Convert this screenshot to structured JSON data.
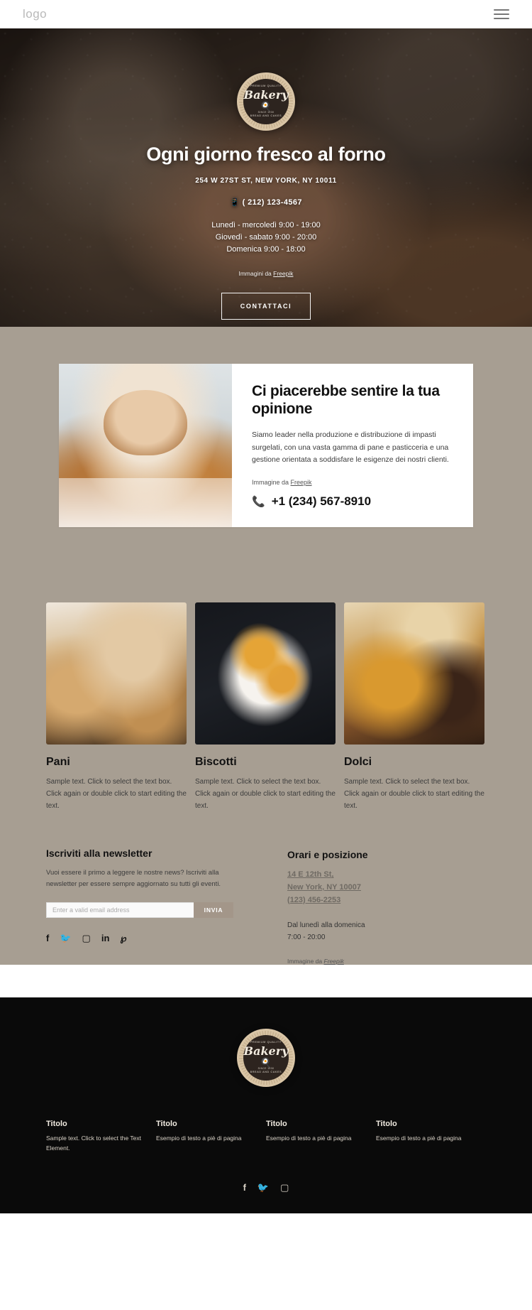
{
  "header": {
    "logo": "logo",
    "menu_icon": "hamburger-menu-icon"
  },
  "hero": {
    "badge": {
      "top": "PREMIUM QUALITY",
      "name": "Bakery",
      "since": "SINCE 1930",
      "bottom": "BREAD AND CAKES"
    },
    "title": "Ogni giorno fresco al forno",
    "address": "254 W 27ST ST, NEW YORK, NY 10011",
    "phone": "( 212) 123-4567",
    "hours": [
      "Lunedì - mercoledì 9:00 - 19:00",
      "Giovedì - sabato 9:00 - 20:00",
      "Domenica 9:00 - 18:00"
    ],
    "credit_prefix": "Immagini da ",
    "credit_link": "Freepik",
    "cta": "CONTATTACI"
  },
  "feature": {
    "title": "Ci piacerebbe sentire la tua opinione",
    "text": "Siamo leader nella produzione e distribuzione di impasti surgelati, con una vasta gamma di pane e pasticceria e una gestione orientata a soddisfare le esigenze dei nostri clienti.",
    "credit_prefix": "Immagine da ",
    "credit_link": "Freepik",
    "phone": "+1 (234) 567-8910",
    "phone_icon": "phone-icon"
  },
  "products": [
    {
      "name": "Pani",
      "desc": "Sample text. Click to select the text box. Click again or double click to start editing the text."
    },
    {
      "name": "Biscotti",
      "desc": "Sample text. Click to select the text box. Click again or double click to start editing the text."
    },
    {
      "name": "Dolci",
      "desc": "Sample text. Click to select the text box. Click again or double click to start editing the text."
    }
  ],
  "newsletter": {
    "title": "Iscriviti alla newsletter",
    "text": "Vuoi essere il primo a leggere le nostre news? Iscriviti alla newsletter per essere sempre aggiornato su tutti gli eventi.",
    "placeholder": "Enter a valid email address",
    "value": "",
    "submit": "INVIA",
    "socials": [
      "facebook-icon",
      "twitter-icon",
      "instagram-icon",
      "linkedin-icon",
      "pinterest-icon"
    ]
  },
  "location": {
    "title": "Orari e posizione",
    "address_line1": "14 E 12th St,",
    "address_line2": "New York, NY 10007",
    "phone": "(123) 456-2253",
    "hours_line1": "Dal lunedì alla domenica",
    "hours_line2": "7:00 - 20:00",
    "credit_prefix": "Immagine da ",
    "credit_link": "Freepik"
  },
  "footer": {
    "badge": {
      "top": "PREMIUM QUALITY",
      "name": "Bakery",
      "since": "SINCE 1930",
      "bottom": "BREAD AND CAKES"
    },
    "columns": [
      {
        "title": "Titolo",
        "text": "Sample text. Click to select the Text Element."
      },
      {
        "title": "Titolo",
        "text": "Esempio di testo a piè di pagina"
      },
      {
        "title": "Titolo",
        "text": "Esempio di testo a piè di pagina"
      },
      {
        "title": "Titolo",
        "text": "Esempio di testo a piè di pagina"
      }
    ],
    "socials": [
      "facebook-icon",
      "twitter-icon",
      "instagram-icon"
    ]
  },
  "colors": {
    "beige": "#a79e92",
    "accent": "#a39689",
    "dark": "#0a0a0a",
    "badge_ring": "#d9c5a6"
  }
}
